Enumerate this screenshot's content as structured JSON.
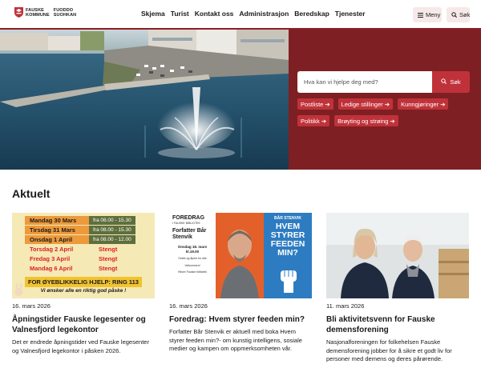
{
  "logo": {
    "line1_left": "FAUSKE",
    "line2_left": "KOMMUNE",
    "line1_right": "FUODDO",
    "line2_right": "SUOHKAN"
  },
  "nav": [
    "Skjema",
    "Turist",
    "Kontakt oss",
    "Administrasjon",
    "Beredskap",
    "Tjenester"
  ],
  "header_buttons": {
    "menu_label": "Meny",
    "search_label": "Søk"
  },
  "hero": {
    "search_placeholder": "Hva kan vi hjelpe deg med?",
    "search_button": "Søk",
    "quick_links": [
      "Postliste",
      "Ledige stillinger",
      "Kunngjøringer",
      "Politikk",
      "Brøyting og strøing"
    ]
  },
  "section_title": "Aktuelt",
  "cards": [
    {
      "date": "16. mars 2026",
      "title": "Åpningstider Fauske legesenter og Valnesfjord legekontor",
      "text": "Det er endrede åpningstider ved Fauske legesenter og Valnesfjord legekontor i påsken 2026.",
      "poster": {
        "rows": [
          {
            "day": "Mandag 30 Mars",
            "value": "fra 08.00 - 15.30",
            "closed": false
          },
          {
            "day": "Tirsdag 31 Mars",
            "value": "fra 08.00 - 15.30",
            "closed": false
          },
          {
            "day": "Onsdag 1 April",
            "value": "fra 08.00 - 12.00",
            "closed": false
          },
          {
            "day": "Torsdag 2 April",
            "value": "Stengt",
            "closed": true
          },
          {
            "day": "Fredag 3 April",
            "value": "Stengt",
            "closed": true
          },
          {
            "day": "Mandag 6 April",
            "value": "Stengt",
            "closed": true
          }
        ],
        "banner": "FOR ØYEBLIKKELIG HJELP: RING 113",
        "footer": "Vi ønsker alle en riktig god påske !"
      }
    },
    {
      "date": "16. mars 2026",
      "title": "Foredrag: Hvem styrer feeden min?",
      "text": "Forfatter Bår Stenvik er aktuell med boka Hvem styrer feeden min?- om kunstig intelligens, sosiale medier og kampen om oppmerksomheten vår.",
      "poster": {
        "heading": "FOREDRAG",
        "sub": "I FAUSKE BIBLIOTEK",
        "name": "Forfatter Bår Stenvik",
        "meta": "Onsdag 18. mars kl.19.00",
        "note1": "Gratis og åpent for alle",
        "note2": "Velkommen!",
        "note3": "Hilsen Fauske bibliotek",
        "cover_author": "BÅR STENVIK",
        "cover_title": "HVEM STYRER FEEDEN MIN?"
      }
    },
    {
      "date": "11. mars 2026",
      "title": "Bli aktivitetsvenn for Fauske demensforening",
      "text": "Nasjonalforeningen for folkehelsen Fauske demensforening jobber for å sikre et godt liv for personer med demens og deres pårørende."
    }
  ],
  "colors": {
    "brand_dark": "#7e1f23",
    "brand_red": "#c0323a",
    "button_tint": "#f7e9e9"
  }
}
